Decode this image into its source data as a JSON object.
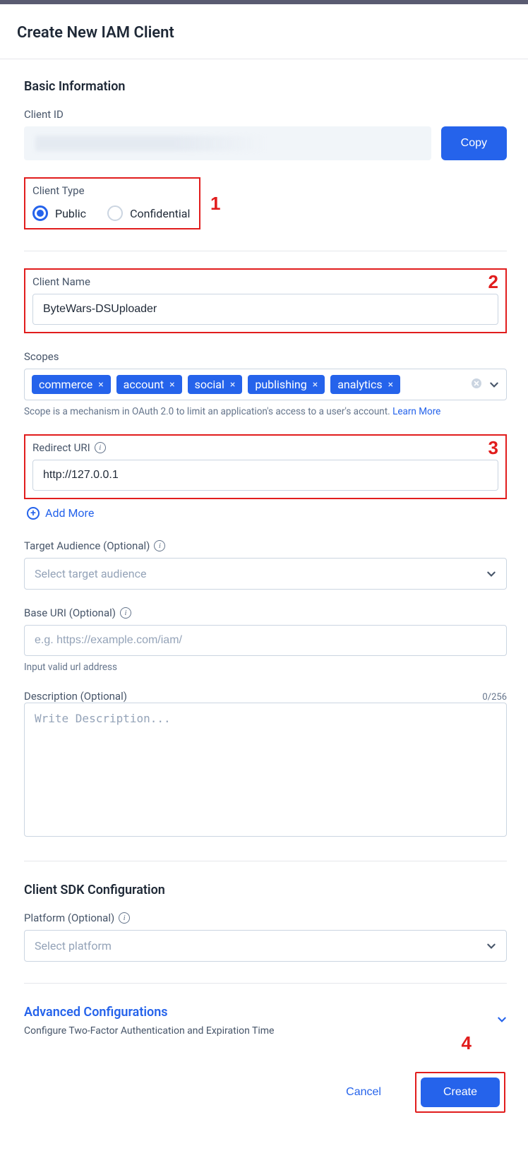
{
  "header": {
    "title": "Create New IAM Client"
  },
  "annotations": {
    "a1": "1",
    "a2": "2",
    "a3": "3",
    "a4": "4"
  },
  "basic": {
    "title": "Basic Information",
    "client_id": {
      "label": "Client ID",
      "value": "",
      "copy_label": "Copy"
    },
    "client_type": {
      "label": "Client Type",
      "options": [
        {
          "label": "Public",
          "checked": true
        },
        {
          "label": "Confidential",
          "checked": false
        }
      ]
    },
    "client_name": {
      "label": "Client Name",
      "value": "ByteWars-DSUploader"
    },
    "scopes": {
      "label": "Scopes",
      "tags": [
        "commerce",
        "account",
        "social",
        "publishing",
        "analytics"
      ],
      "helper_prefix": "Scope is a mechanism in OAuth 2.0 to limit an application's access to a user's account. ",
      "helper_link": "Learn More"
    },
    "redirect_uri": {
      "label": "Redirect URI",
      "value": "http://127.0.0.1",
      "add_more": "Add More"
    },
    "target_audience": {
      "label": "Target Audience (Optional)",
      "placeholder": "Select target audience"
    },
    "base_uri": {
      "label": "Base URI (Optional)",
      "placeholder": "e.g. https://example.com/iam/",
      "helper": "Input valid url address"
    },
    "description": {
      "label": "Description (Optional)",
      "count": "0/256",
      "placeholder": "Write Description..."
    }
  },
  "sdk": {
    "title": "Client SDK Configuration",
    "platform": {
      "label": "Platform (Optional)",
      "placeholder": "Select platform"
    }
  },
  "advanced": {
    "title": "Advanced Configurations",
    "subtitle": "Configure Two-Factor Authentication and Expiration Time"
  },
  "footer": {
    "cancel": "Cancel",
    "create": "Create"
  }
}
